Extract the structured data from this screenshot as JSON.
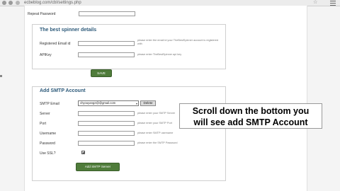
{
  "browser": {
    "url": "ecbeblog.com/cbl/settings.php"
  },
  "top_form": {
    "repeat_password_label": "Repeat Password"
  },
  "spinner_section": {
    "title": "The best spinner details",
    "fields": [
      {
        "label": "Registered Email id",
        "help": "please enter the email id your TheBestSpinner account is registered with"
      },
      {
        "label": "APIKey",
        "help": "please enter TheBestSpinner api key"
      }
    ],
    "save_button": "SAVE"
  },
  "smtp_section": {
    "title": "Add SMTP Account",
    "smtp_email_label": "SMTP Email",
    "smtp_email_selected": "chyouyang2@@gmail.com",
    "delete_button": "Delete",
    "fields": [
      {
        "label": "Server",
        "help": "please enter your SMTP Server"
      },
      {
        "label": "Port",
        "help": "please enter your SMTP Port"
      },
      {
        "label": "Username",
        "help": "please enter SMTP username"
      },
      {
        "label": "Password",
        "help": "please enter the SMTP Password"
      }
    ],
    "use_ssl_label": "Use SSL?",
    "add_button": "Add SMTP Server"
  },
  "overlay": {
    "line1": "Scroll down the bottom you",
    "line2": "will see add SMTP Account"
  }
}
